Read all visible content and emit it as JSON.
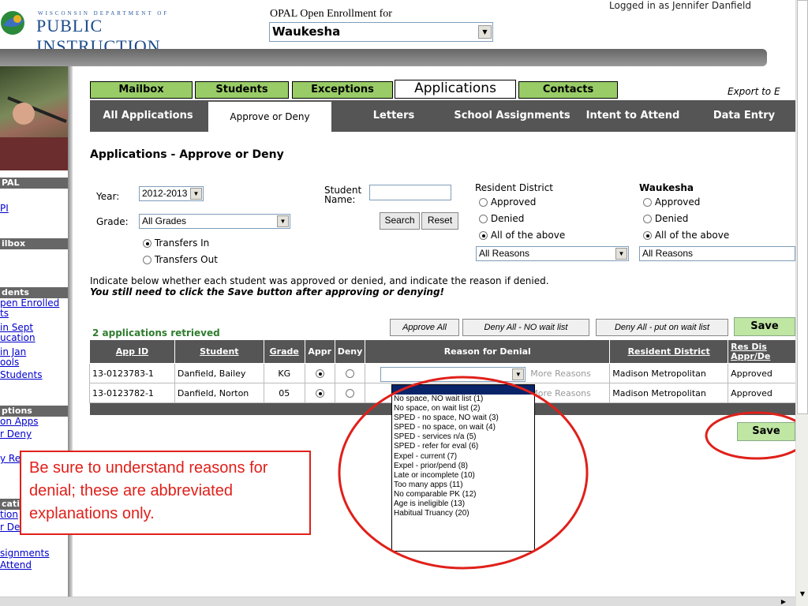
{
  "header": {
    "logo_top": "WISCONSIN DEPARTMENT OF",
    "logo_main": "PUBLIC INSTRUCTION",
    "opal_label": "OPAL Open Enrollment for",
    "district_select": "Waukesha",
    "logged_in": "Logged in as Jennifer Danfield"
  },
  "sidebar": {
    "sections": [
      {
        "header": "PAL",
        "links": [
          "PI"
        ]
      },
      {
        "header": "ilbox",
        "links": []
      },
      {
        "header": "dents",
        "links": [
          "pen Enrolled",
          "ts",
          "in Sept",
          "ucation",
          "in Jan",
          "ools",
          "Students"
        ]
      },
      {
        "header": "ptions",
        "links": [
          "on Apps",
          "r Deny",
          "",
          "y Re"
        ]
      },
      {
        "header": "cati",
        "links": [
          "tion",
          "r De",
          "",
          "signments",
          "Attend"
        ]
      }
    ]
  },
  "tabs_top": [
    "Mailbox",
    "Students",
    "Exceptions",
    "Applications",
    "Contacts"
  ],
  "export_label": "Export to E",
  "tabs_sub": [
    "All Applications",
    "Approve or Deny",
    "Letters",
    "School Assignments",
    "Intent to Attend",
    "Data Entry"
  ],
  "page_title": "Applications - Approve or Deny",
  "filters": {
    "year_label": "Year:",
    "year_value": "2012-2013",
    "grade_label": "Grade:",
    "grade_value": "All Grades",
    "transfers_in": "Transfers In",
    "transfers_out": "Transfers Out",
    "student_name_label1": "Student",
    "student_name_label2": "Name:",
    "student_name_value": "",
    "search_btn": "Search",
    "reset_btn": "Reset",
    "resident_title": "Resident District",
    "resident_options": [
      "Approved",
      "Denied",
      "All of the above"
    ],
    "resident_reason": "All Reasons",
    "nonres_title": "Waukesha",
    "nonres_options": [
      "Approved",
      "Denied",
      "All of the above"
    ],
    "nonres_reason": "All Reasons"
  },
  "instructions": {
    "line1": "Indicate below whether each student was approved or denied, and indicate the reason if denied.",
    "line2": "You still need to click the Save button after approving or denying!"
  },
  "results": {
    "count": "2 applications retrieved",
    "approve_all": "Approve All",
    "deny_all_no_wait": "Deny All - NO wait list",
    "deny_all_wait": "Deny All - put on wait list",
    "save": "Save"
  },
  "table": {
    "headers": [
      "App ID",
      "Student",
      "Grade",
      "Appr",
      "Deny",
      "Reason for Denial",
      "Resident District",
      "Res Dis Appr/De"
    ],
    "rows": [
      {
        "app_id": "13-0123783-1",
        "student": "Danfield, Bailey",
        "grade": "KG",
        "more": "More Reasons",
        "district": "Madison Metropolitan",
        "status": "Approved"
      },
      {
        "app_id": "13-0123782-1",
        "student": "Danfield, Norton",
        "grade": "05",
        "more": "More Reasons",
        "district": "Madison Metropolitan",
        "status": "Approved"
      }
    ]
  },
  "dropdown_options": [
    "No space, NO wait list (1)",
    "No space, on wait list (2)",
    "SPED - no space, NO wait (3)",
    "SPED - no space, on wait (4)",
    "SPED - services n/a (5)",
    "SPED - refer for eval (6)",
    "Expel - current (7)",
    "Expel - prior/pend (8)",
    "Late or incomplete (10)",
    "Too many apps (11)",
    "No comparable PK (12)",
    "Age is ineligible (13)",
    "Habitual Truancy (20)"
  ],
  "save_bottom": "Save",
  "callout": "Be sure to understand reasons for denial; these are abbreviated explanations only.",
  "colors": {
    "tab_green": "#99cc66",
    "tab_dark": "#555555",
    "annotation_red": "#e0201a",
    "save_green": "#bfe6a3"
  }
}
